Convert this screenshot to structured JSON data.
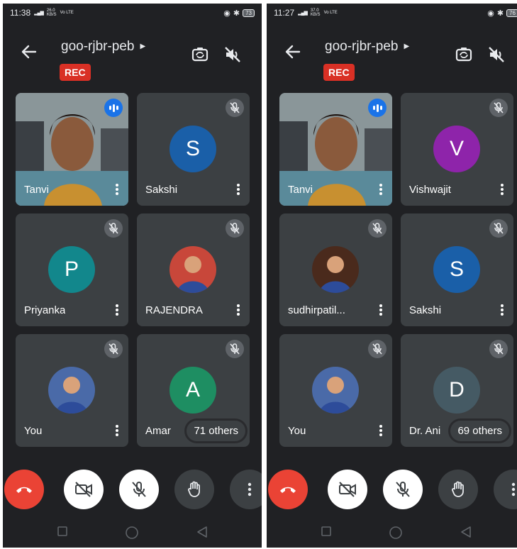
{
  "screens": [
    {
      "status": {
        "time": "11:38",
        "speed_top": "26.0",
        "speed_bottom": "KB/S",
        "net": "Vo LTE",
        "battery": "73"
      },
      "meeting": {
        "code": "goo-rjbr-peb",
        "rec_label": "REC"
      },
      "tiles": [
        {
          "name": "Tanvi",
          "kind": "video",
          "speaking": true
        },
        {
          "name": "Sakshi",
          "kind": "initial",
          "initial": "S",
          "color": "#1a5fa8"
        },
        {
          "name": "Priyanka",
          "kind": "initial",
          "initial": "P",
          "color": "#12878c"
        },
        {
          "name": "RAJENDRA",
          "kind": "photo",
          "color": "#c8473a"
        },
        {
          "name": "You",
          "kind": "photo",
          "color": "#4a6aa8"
        },
        {
          "name": "Amar",
          "kind": "initial",
          "initial": "A",
          "color": "#1e8e62"
        }
      ],
      "others_label": "71 others"
    },
    {
      "status": {
        "time": "11:27",
        "speed_top": "37.0",
        "speed_bottom": "KB/S",
        "net": "Vo LTE",
        "battery": "76"
      },
      "meeting": {
        "code": "goo-rjbr-peb",
        "rec_label": "REC"
      },
      "tiles": [
        {
          "name": "Tanvi",
          "kind": "video",
          "speaking": true
        },
        {
          "name": "Vishwajit",
          "kind": "initial",
          "initial": "V",
          "color": "#8e24aa"
        },
        {
          "name": "sudhirpatil...",
          "kind": "photo",
          "color": "#4a2a1c"
        },
        {
          "name": "Sakshi",
          "kind": "initial",
          "initial": "S",
          "color": "#1a5fa8"
        },
        {
          "name": "You",
          "kind": "photo",
          "color": "#4a6aa8"
        },
        {
          "name": "Dr. Ani",
          "kind": "initial",
          "initial": "D",
          "color": "#455a64"
        }
      ],
      "others_label": "69 others"
    }
  ],
  "colors": {
    "background": "#202124",
    "tile": "#3c4043",
    "end_call": "#ea4335",
    "rec": "#d93025",
    "speaking": "#1a73e8"
  }
}
